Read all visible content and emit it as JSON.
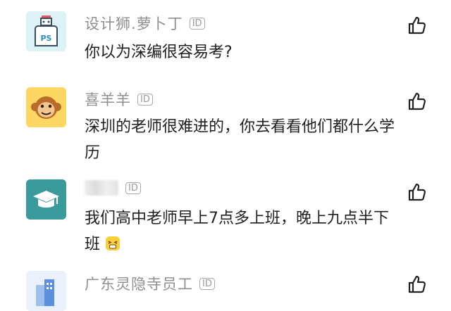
{
  "comments": [
    {
      "username": "设计狮.萝卜丁",
      "badge": "ID",
      "text": "你以为深编很容易考?",
      "avatar_icon": "ps-robot-icon",
      "avatar_text": "PS"
    },
    {
      "username": "喜羊羊",
      "badge": "ID",
      "text": "深圳的老师很难进的，你去看看他们都什么学历",
      "avatar_icon": "monkey-face-icon"
    },
    {
      "username": "",
      "badge": "ID",
      "text": "我们高中老师早上7点多上班，晚上九点半下班",
      "text_emoji": "tired-face-emoji",
      "avatar_icon": "graduation-cap-icon"
    },
    {
      "username": "广东灵隐寺员工",
      "badge": "ID",
      "text": "",
      "avatar_icon": "building-icon"
    }
  ],
  "colors": {
    "username": "#8f8f8f",
    "text": "#1f1f1f",
    "avatar_ps_bg": "#dcf2f6",
    "avatar_monkey_bg": "#fcd863",
    "avatar_cap_bg": "#3b9a9c"
  }
}
